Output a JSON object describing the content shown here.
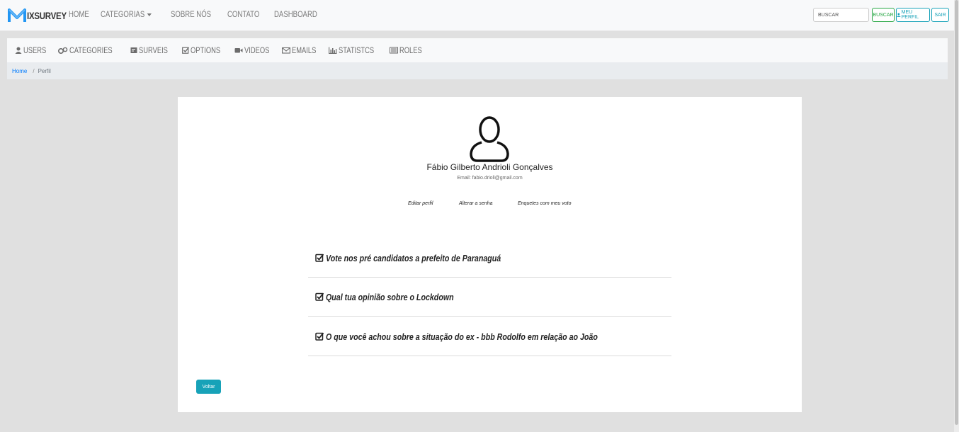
{
  "brand": {
    "logo_letter": "M",
    "name": "IXSURVEY"
  },
  "nav": {
    "items": [
      "HOME",
      "CATEGORIAS",
      "SOBRE NÓS",
      "CONTATO",
      "DASHBOARD"
    ]
  },
  "search": {
    "placeholder": "BUSCAR",
    "button": "BUSCAR"
  },
  "header_buttons": {
    "profile": "MEU PERFIL",
    "logout": "SAIR"
  },
  "admin_nav": [
    {
      "label": "USERS",
      "icon": "user-icon"
    },
    {
      "label": "CATEGORIES",
      "icon": "cogs-icon"
    },
    {
      "label": "SURVEIS",
      "icon": "poll-icon"
    },
    {
      "label": "OPTIONS",
      "icon": "check-square-icon"
    },
    {
      "label": "VIDEOS",
      "icon": "video-icon"
    },
    {
      "label": "EMAILS",
      "icon": "envelope-icon"
    },
    {
      "label": "STATISTCS",
      "icon": "bar-chart-icon"
    },
    {
      "label": "ROLES",
      "icon": "list-icon"
    }
  ],
  "breadcrumb": {
    "home": "Home",
    "separator": "/",
    "current": "Perfil"
  },
  "profile": {
    "name": "Fábio Gilberto Andrioli Gonçalves",
    "email_label": "Email:",
    "email": "fabio.drioli@gmail.com",
    "actions": [
      "Editar perfil",
      "Alterar a senha",
      "Enquetes com meu voto"
    ]
  },
  "surveys": [
    "Vote nos pré candidatos a prefeito de Paranaguá",
    "Qual tua opinião sobre o Lockdown",
    "O que você achou sobre a situação do ex - bbb Rodolfo em relação ao João"
  ],
  "back_button": "Voltar",
  "colors": {
    "primary": "#007bff",
    "info": "#17a2b8",
    "success": "#28a745",
    "logo_blue": "#2196f3"
  }
}
